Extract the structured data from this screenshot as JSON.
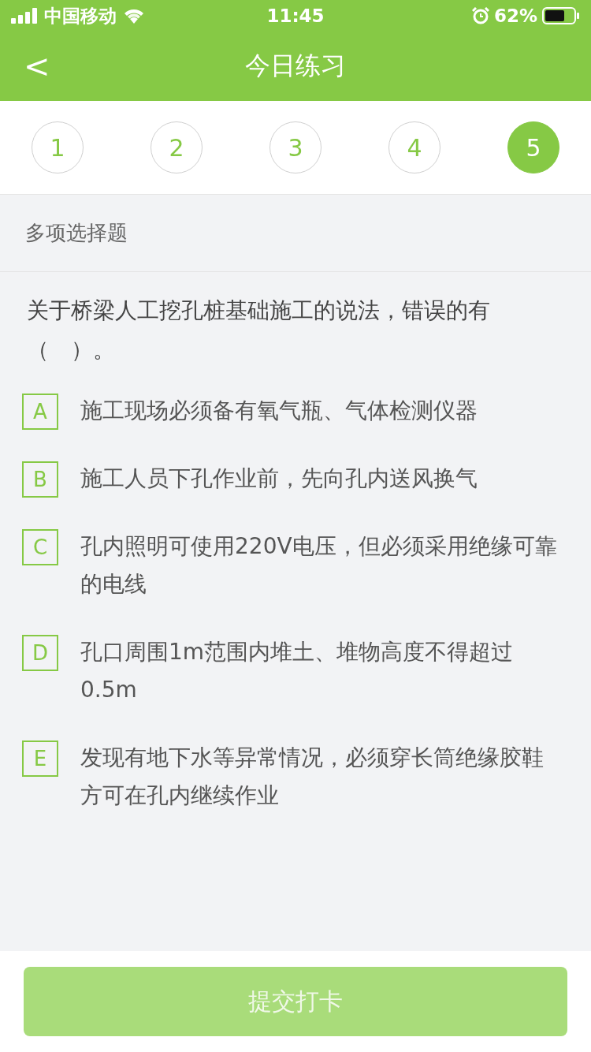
{
  "status_bar": {
    "carrier": "中国移动",
    "time": "11:45",
    "battery": "62%"
  },
  "nav": {
    "back": "<",
    "title": "今日练习"
  },
  "steps": [
    {
      "label": "1",
      "selected": false
    },
    {
      "label": "2",
      "selected": false
    },
    {
      "label": "3",
      "selected": false
    },
    {
      "label": "4",
      "selected": false
    },
    {
      "label": "5",
      "selected": true
    }
  ],
  "section": "多项选择题",
  "question": "关于桥梁人工挖孔桩基础施工的说法，错误的有（　）。",
  "options": [
    {
      "letter": "A",
      "text": "施工现场必须备有氧气瓶、气体检测仪器",
      "selected": false
    },
    {
      "letter": "B",
      "text": "施工人员下孔作业前，先向孔内送风换气",
      "selected": false
    },
    {
      "letter": "C",
      "text": "孔内照明可使用220V电压，但必须采用绝缘可靠的电线",
      "selected": false
    },
    {
      "letter": "D",
      "text": "孔口周围1m范围内堆土、堆物高度不得超过0.5m",
      "selected": false
    },
    {
      "letter": "E",
      "text": "发现有地下水等异常情况，必须穿长筒绝缘胶鞋方可在孔内继续作业",
      "selected": false
    }
  ],
  "submit": {
    "label": "提交打卡",
    "disabled": true
  }
}
